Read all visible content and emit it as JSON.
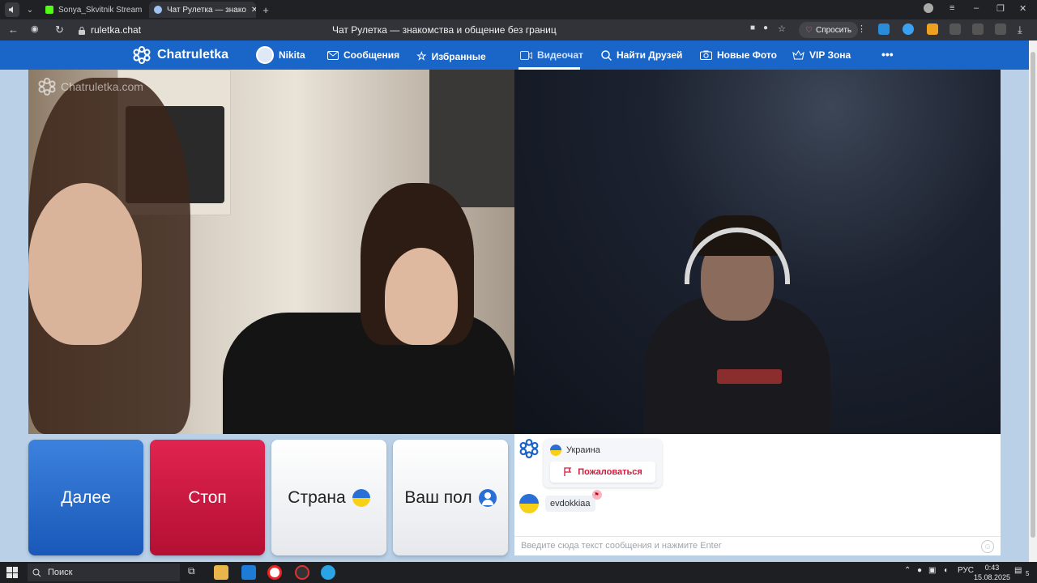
{
  "browser": {
    "tabs": [
      {
        "title": "Sonya_Skvitnik Stream - Ki",
        "active": false
      },
      {
        "title": "Чат Рулетка — знако",
        "active": true
      }
    ],
    "url": "ruletka.chat",
    "page_title": "Чат Рулетка — знакомства и общение без границ",
    "ask_button": "Спросить"
  },
  "site": {
    "logo": "Chatruletka",
    "nav": [
      {
        "label": "Nikita",
        "icon": "user-avatar-icon"
      },
      {
        "label": "Сообщения",
        "icon": "mail-icon"
      },
      {
        "label": "Избранные",
        "icon": "star-icon"
      },
      {
        "label": "Видеочат",
        "icon": "video-icon",
        "active": true
      },
      {
        "label": "Найти Друзей",
        "icon": "search-icon"
      },
      {
        "label": "Новые Фото",
        "icon": "camera-icon"
      },
      {
        "label": "VIP Зона",
        "icon": "crown-icon"
      },
      {
        "label": "•••",
        "icon": "more-icon"
      }
    ],
    "accent": "#1a65c8"
  },
  "video": {
    "watermark": "Chatruletka.com"
  },
  "controls": {
    "next_label": "Далее",
    "stop_label": "Стоп",
    "country_label": "Страна",
    "gender_label": "Ваш пол",
    "next_color": "#1958b8",
    "stop_color": "#b40f34"
  },
  "chat": {
    "country": "Украина",
    "report_label": "Пожаловаться",
    "username": "evdokkiaa",
    "input_placeholder": "Введите сюда текст сообщения и нажмите Enter"
  },
  "taskbar": {
    "search_label": "Поиск",
    "lang": "РУС",
    "time": "0:43",
    "date": "15.08.2025",
    "notifications": "5"
  }
}
